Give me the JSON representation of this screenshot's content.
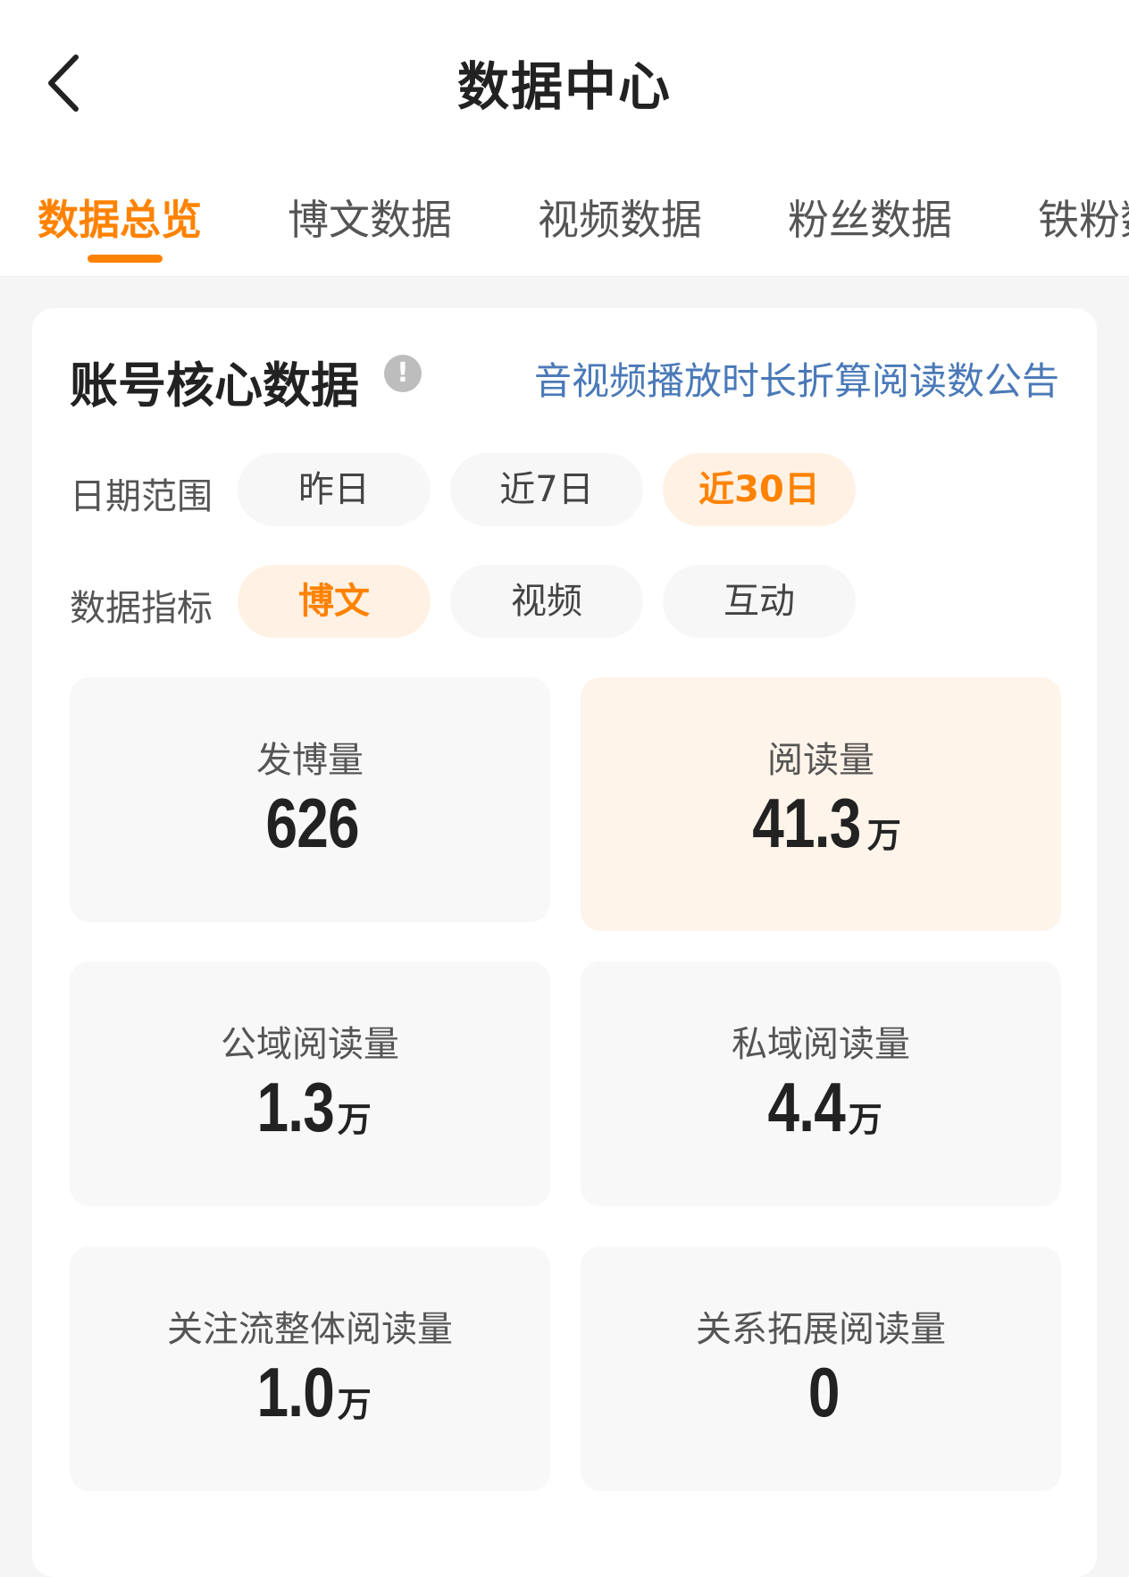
{
  "header": {
    "title": "数据中心",
    "back_icon": "chevron-left-icon"
  },
  "tabs": [
    {
      "label": "数据总览",
      "active": true
    },
    {
      "label": "博文数据",
      "active": false
    },
    {
      "label": "视频数据",
      "active": false
    },
    {
      "label": "粉丝数据",
      "active": false
    },
    {
      "label": "铁粉数",
      "active": false
    }
  ],
  "core": {
    "title": "账号核心数据",
    "info_icon": "!",
    "notice_link": "音视频播放时长折算阅读数公告"
  },
  "filters": {
    "date_range": {
      "label": "日期范围",
      "options": [
        "昨日",
        "近7日",
        "近30日"
      ],
      "selected": "近30日"
    },
    "metric": {
      "label": "数据指标",
      "options": [
        "博文",
        "视频",
        "互动"
      ],
      "selected": "博文"
    }
  },
  "stats": [
    {
      "label": "发博量",
      "value": "626",
      "unit": ""
    },
    {
      "label": "阅读量",
      "value": "41.3",
      "unit": "万"
    },
    {
      "label": "公域阅读量",
      "value": "1.3",
      "unit": "万"
    },
    {
      "label": "私域阅读量",
      "value": "4.4",
      "unit": "万"
    },
    {
      "label": "关注流整体阅读量",
      "value": "1.0",
      "unit": "万"
    },
    {
      "label": "关系拓展阅读量",
      "value": "0",
      "unit": ""
    }
  ],
  "colors": {
    "accent": "#ff8200",
    "accent_bg": "#fff2e5",
    "link": "#4a79b8"
  }
}
